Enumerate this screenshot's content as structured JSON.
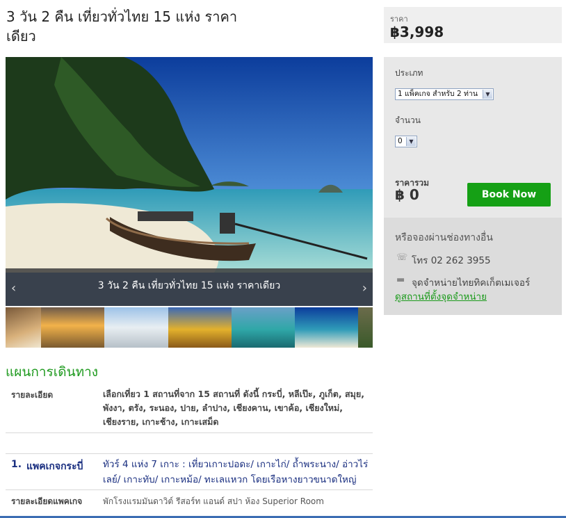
{
  "tour": {
    "title": "3 วัน 2 คืน เที่ยวทั่วไทย 15 แห่ง ราคาเดียว",
    "slide_caption": "3 วัน 2 คืน เที่ยวทั่วไทย 15 แห่ง ราคาเดียว",
    "prev_icon": "‹",
    "next_icon": "›"
  },
  "itinerary": {
    "section_title": "แผนการเดินทาง",
    "detail_label": "รายละเอียด",
    "detail_text": "เลือกเที่ยว 1 สถานที่จาก 15 สถานที่ ดังนี้ กระบี่, หลีเป๊ะ, ภูเก็ต, สมุย, พังงา, ตรัง, ระนอง, ปาย, ลำปาง, เชียงคาน, เขาค้อ, เชียงใหม่, เชียงราย, เกาะช้าง, เกาะเสม็ด",
    "package": {
      "number": "1.",
      "name": "แพคเกจกระบี่",
      "description": "ทัวร์ 4 แห่ง 7 เกาะ : เที่ยวเกาะปอดะ/ เกาะไก่/ ถ้ำพระนาง/ อ่าวไร่เลย์/ เกาะทับ/ เกาะหม้อ/ ทะเลแหวก โดยเรือหางยาวขนาดใหญ่",
      "detail_label": "รายละเอียดแพคเกจ",
      "detail_text": "พักโรงแรมมันดาวิต์ รีสอร์ท แอนด์ สปา ห้อง Superior Room"
    }
  },
  "booking": {
    "price_label": "ราคา",
    "price_value": "฿3,998",
    "type_label": "ประเภท",
    "type_selected": "1 แพ็คเกจ สำหรับ 2 ท่าน",
    "qty_label": "จำนวน",
    "qty_selected": "0",
    "total_label": "ราคารวม",
    "total_value": "฿ 0",
    "book_button": "Book Now"
  },
  "contact": {
    "title": "หรือจองผ่านช่องทางอื่น",
    "phone": "โทร 02 262 3955",
    "agent": "จุดจำหน่ายไทยทิคเก็ตเมเจอร์",
    "link": "ดูสถานที่ตั้งจุดจำหน่าย",
    "phone_icon": "phone-icon",
    "ticket_icon": "ticket-icon"
  },
  "colors": {
    "accent_green": "#15a015",
    "section_green": "#1f9a1f",
    "package_blue": "#1a2f80"
  }
}
